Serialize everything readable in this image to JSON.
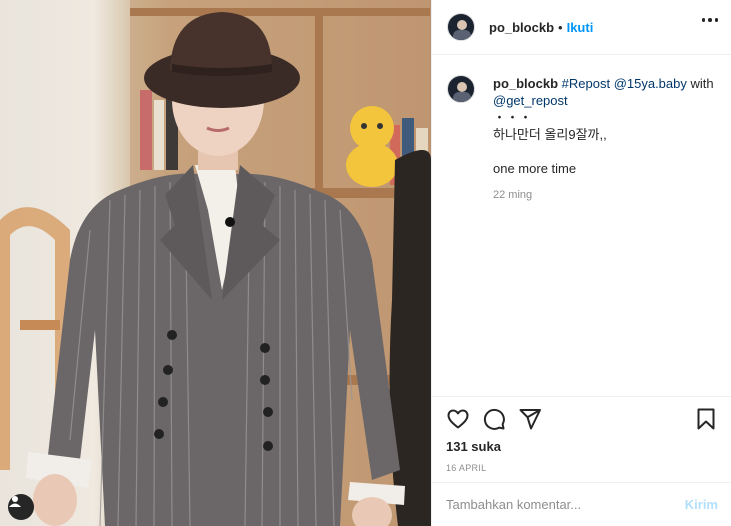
{
  "post": {
    "username": "po_blockb",
    "dot": "•",
    "follow_label": "Ikuti",
    "caption": {
      "username": "po_blockb",
      "repost_tag": "#Repost",
      "source_handle": "@15ya.baby",
      "with_word": "with",
      "app_handle": "@get_repost",
      "dots": "・・・",
      "korean_line": "하나만더 올리9잘까,,",
      "english_line": "one more time",
      "time": "22 ming"
    },
    "likes": "131 suka",
    "date": "16 APRIL",
    "comment_placeholder": "Tambahkan komentar...",
    "send_label": "Kirim"
  },
  "icons": [
    "more-icon",
    "heart-icon",
    "comment-icon",
    "share-icon",
    "bookmark-icon",
    "user-tag-icon"
  ],
  "colors": {
    "accent": "#0095f6",
    "send_disabled": "#b2dffc",
    "text": "#262626",
    "muted": "#8e8e8e",
    "border": "#efefef"
  }
}
